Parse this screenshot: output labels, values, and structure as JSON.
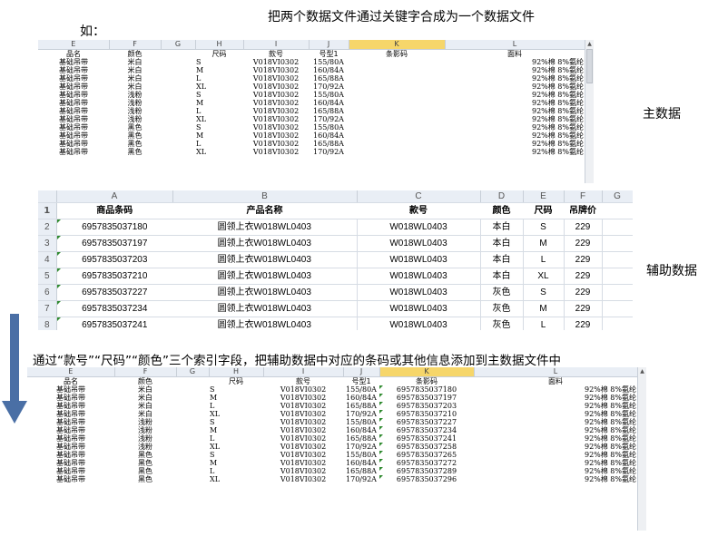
{
  "title": "把两个数据文件通过关键字合成为一个数据文件",
  "example_label": "如：",
  "main_label": "主数据",
  "aux_label": "辅助数据",
  "instruction": "通过“款号”“尺码”“颜色”三个索引字段，把辅助数据中对应的条码或其他信息添加到主数据文件中",
  "main_sheet": {
    "columns": [
      "E",
      "F",
      "G",
      "H",
      "I",
      "J",
      "K",
      "L"
    ],
    "headers": [
      "品名",
      "颜色",
      "",
      "尺码",
      "款号",
      "号型1",
      "条影码",
      "面料"
    ],
    "rows": [
      [
        "基础吊带",
        "米白",
        "",
        "S",
        "V018VI0302",
        "155/80A",
        "",
        "92%棉  8%氨纶"
      ],
      [
        "基础吊带",
        "米白",
        "",
        "M",
        "V018VI0302",
        "160/84A",
        "",
        "92%棉  8%氨纶"
      ],
      [
        "基础吊带",
        "米白",
        "",
        "L",
        "V018VI0302",
        "165/88A",
        "",
        "92%棉  8%氨纶"
      ],
      [
        "基础吊带",
        "米白",
        "",
        "XL",
        "V018VI0302",
        "170/92A",
        "",
        "92%棉  8%氨纶"
      ],
      [
        "基础吊带",
        "浅粉",
        "",
        "S",
        "V018VI0302",
        "155/80A",
        "",
        "92%棉  8%氨纶"
      ],
      [
        "基础吊带",
        "浅粉",
        "",
        "M",
        "V018VI0302",
        "160/84A",
        "",
        "92%棉  8%氨纶"
      ],
      [
        "基础吊带",
        "浅粉",
        "",
        "L",
        "V018VI0302",
        "165/88A",
        "",
        "92%棉  8%氨纶"
      ],
      [
        "基础吊带",
        "浅粉",
        "",
        "XL",
        "V018VI0302",
        "170/92A",
        "",
        "92%棉  8%氨纶"
      ],
      [
        "基础吊带",
        "黑色",
        "",
        "S",
        "V018VI0302",
        "155/80A",
        "",
        "92%棉  8%氨纶"
      ],
      [
        "基础吊带",
        "黑色",
        "",
        "M",
        "V018VI0302",
        "160/84A",
        "",
        "92%棉  8%氨纶"
      ],
      [
        "基础吊带",
        "黑色",
        "",
        "L",
        "V018VI0302",
        "165/88A",
        "",
        "92%棉  8%氨纶"
      ],
      [
        "基础吊带",
        "黑色",
        "",
        "XL",
        "V018VI0302",
        "170/92A",
        "",
        "92%棉  8%氨纶"
      ]
    ]
  },
  "aux_sheet": {
    "columns": [
      "A",
      "B",
      "C",
      "D",
      "E",
      "F",
      "G"
    ],
    "headers": [
      "商品条码",
      "产品名称",
      "款号",
      "颜色",
      "尺码",
      "吊牌价"
    ],
    "rows": [
      [
        "2",
        "6957835037180",
        "圆领上衣W018WL0403",
        "W018WL0403",
        "本白",
        "S",
        "229"
      ],
      [
        "3",
        "6957835037197",
        "圆领上衣W018WL0403",
        "W018WL0403",
        "本白",
        "M",
        "229"
      ],
      [
        "4",
        "6957835037203",
        "圆领上衣W018WL0403",
        "W018WL0403",
        "本白",
        "L",
        "229"
      ],
      [
        "5",
        "6957835037210",
        "圆领上衣W018WL0403",
        "W018WL0403",
        "本白",
        "XL",
        "229"
      ],
      [
        "6",
        "6957835037227",
        "圆领上衣W018WL0403",
        "W018WL0403",
        "灰色",
        "S",
        "229"
      ],
      [
        "7",
        "6957835037234",
        "圆领上衣W018WL0403",
        "W018WL0403",
        "灰色",
        "M",
        "229"
      ],
      [
        "8",
        "6957835037241",
        "圆领上衣W018WL0403",
        "W018WL0403",
        "灰色",
        "L",
        "229"
      ]
    ]
  },
  "result_sheet": {
    "columns": [
      "E",
      "F",
      "G",
      "H",
      "I",
      "J",
      "K",
      "L"
    ],
    "headers": [
      "品名",
      "颜色",
      "",
      "尺码",
      "款号",
      "号型1",
      "条影码",
      "面料"
    ],
    "rows": [
      [
        "基础吊带",
        "米白",
        "",
        "S",
        "V018VI0302",
        "155/80A",
        "6957835037180",
        "92%棉  8%氨纶"
      ],
      [
        "基础吊带",
        "米白",
        "",
        "M",
        "V018VI0302",
        "160/84A",
        "6957835037197",
        "92%棉  8%氨纶"
      ],
      [
        "基础吊带",
        "米白",
        "",
        "L",
        "V018VI0302",
        "165/88A",
        "6957835037203",
        "92%棉  8%氨纶"
      ],
      [
        "基础吊带",
        "米白",
        "",
        "XL",
        "V018VI0302",
        "170/92A",
        "6957835037210",
        "92%棉  8%氨纶"
      ],
      [
        "基础吊带",
        "浅粉",
        "",
        "S",
        "V018VI0302",
        "155/80A",
        "6957835037227",
        "92%棉  8%氨纶"
      ],
      [
        "基础吊带",
        "浅粉",
        "",
        "M",
        "V018VI0302",
        "160/84A",
        "6957835037234",
        "92%棉  8%氨纶"
      ],
      [
        "基础吊带",
        "浅粉",
        "",
        "L",
        "V018VI0302",
        "165/88A",
        "6957835037241",
        "92%棉  8%氨纶"
      ],
      [
        "基础吊带",
        "浅粉",
        "",
        "XL",
        "V018VI0302",
        "170/92A",
        "6957835037258",
        "92%棉  8%氨纶"
      ],
      [
        "基础吊带",
        "黑色",
        "",
        "S",
        "V018VI0302",
        "155/80A",
        "6957835037265",
        "92%棉  8%氨纶"
      ],
      [
        "基础吊带",
        "黑色",
        "",
        "M",
        "V018VI0302",
        "160/84A",
        "6957835037272",
        "92%棉  8%氨纶"
      ],
      [
        "基础吊带",
        "黑色",
        "",
        "L",
        "V018VI0302",
        "165/88A",
        "6957835037289",
        "92%棉  8%氨纶"
      ],
      [
        "基础吊带",
        "黑色",
        "",
        "XL",
        "V018VI0302",
        "170/92A",
        "6957835037296",
        "92%棉  8%氨纶"
      ]
    ]
  },
  "colors": {
    "selected_column": "#f6d66a",
    "header_bg": "#e9eef5",
    "arrow": "#4a6fa5",
    "indicator": "#2f8a2f"
  }
}
